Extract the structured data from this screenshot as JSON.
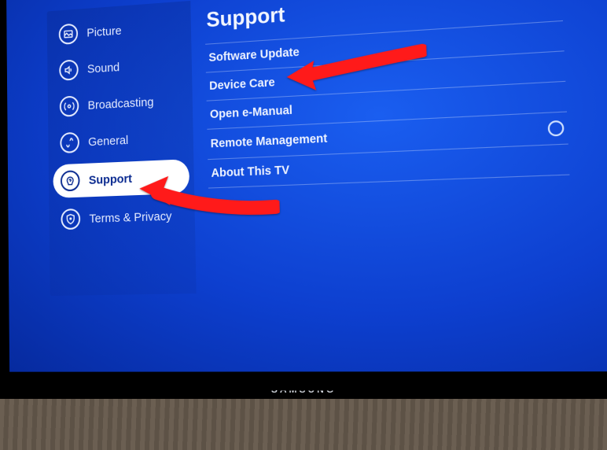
{
  "brand": "SAMSUNG",
  "sidebar": {
    "items": [
      {
        "icon": "picture-icon",
        "label": "Picture"
      },
      {
        "icon": "sound-icon",
        "label": "Sound"
      },
      {
        "icon": "broadcasting-icon",
        "label": "Broadcasting"
      },
      {
        "icon": "general-icon",
        "label": "General"
      },
      {
        "icon": "support-icon",
        "label": "Support",
        "selected": true
      },
      {
        "icon": "privacy-icon",
        "label": "Terms & Privacy"
      }
    ]
  },
  "main": {
    "title": "Support",
    "rows": [
      {
        "label": "Software Update",
        "has_toggle": false
      },
      {
        "label": "Device Care",
        "has_toggle": false,
        "highlighted": true
      },
      {
        "label": "Open e-Manual",
        "has_toggle": false
      },
      {
        "label": "Remote Management",
        "has_toggle": true
      },
      {
        "label": "About This TV",
        "has_toggle": false
      }
    ]
  },
  "annotations": {
    "arrow_color": "#ff1a1a"
  }
}
